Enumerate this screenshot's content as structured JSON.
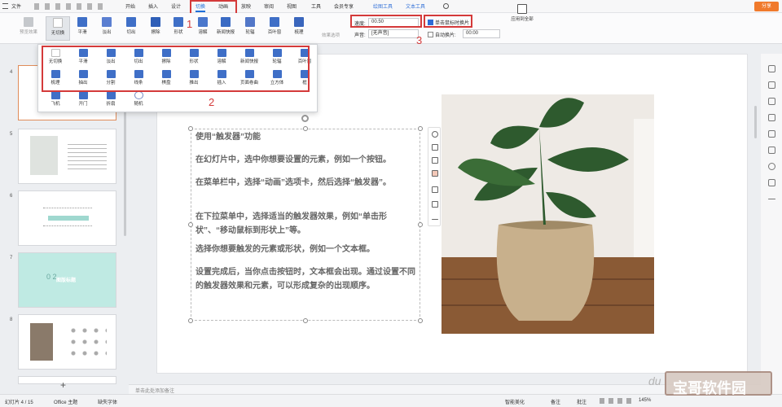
{
  "menubar": {
    "file": "文件",
    "tabs": [
      "开始",
      "插入",
      "设计",
      "切换",
      "动画",
      "放映",
      "审阅",
      "视图",
      "工具",
      "会员专享"
    ],
    "drawing_tools": "绘图工具",
    "text_tools": "文本工具",
    "share": "分享"
  },
  "ribbon": {
    "preview": "预览效果",
    "effects": [
      "无切换",
      "平滑",
      "淡出",
      "切出",
      "擦除",
      "形状",
      "溶解",
      "新闻快报",
      "轮辐",
      "百叶窗",
      "梳理"
    ],
    "effect_options": "效果选项",
    "speed_label": "速度:",
    "speed_value": "00.50",
    "sound_label": "声音:",
    "sound_value": "[无声音]",
    "click_to_switch": "单击鼠标时换片",
    "auto_switch": "自动换片:",
    "auto_switch_value": "00:00",
    "apply_all": "应用到全部"
  },
  "annotations": [
    "1",
    "2",
    "3"
  ],
  "dropdown": {
    "row1": [
      "无切换",
      "平滑",
      "淡出",
      "切出",
      "擦除",
      "形状",
      "溶解",
      "新闻快报",
      "轮辐",
      "百叶窗"
    ],
    "row2": [
      "梳理",
      "抽出",
      "分割",
      "线条",
      "棋盘",
      "推出",
      "插入",
      "页面卷曲",
      "立方体",
      "框"
    ],
    "row3": [
      "飞机",
      "开门",
      "折扇",
      "随机"
    ]
  },
  "thumbnails": {
    "numbers": [
      "4",
      "5",
      "6",
      "7",
      "8"
    ],
    "slide7_title": "图版标题",
    "slide7_nums": "0 2",
    "add": "+"
  },
  "slide": {
    "paragraphs": [
      "使用“触发器”功能",
      "在幻灯片中，选中你想要设置的元素，例如一个按钮。",
      "在菜单栏中，选择“动画”选项卡，然后选择“触发器”。",
      "在下拉菜单中，选择适当的触发器效果，例如“单击形状”、“移动鼠标到形状上”等。",
      "选择你想要触发的元素或形状，例如一个文本框。",
      "设置完成后，当你点击按钮时，文本框会出现。通过设置不同的触发器效果和元素，可以形成复杂的出现顺序。"
    ]
  },
  "statusbar": {
    "slide_counter": "幻灯片 4 / 15",
    "theme": "Office 主题",
    "missing_font": "缺失字体",
    "notes_hint": "单击此处添加备注",
    "beautify": "智能美化",
    "notes": "备注",
    "comments": "批注",
    "zoom": "145%"
  },
  "watermark": {
    "brand": "宝哥软件园",
    "du": "du"
  }
}
